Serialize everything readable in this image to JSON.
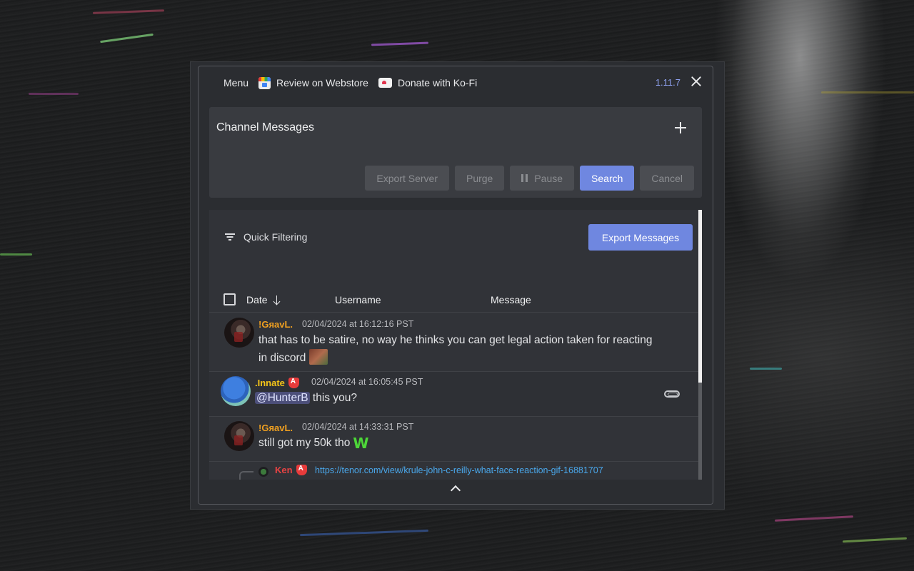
{
  "topbar": {
    "menu_label": "Menu",
    "review_label": "Review on Webstore",
    "donate_label": "Donate with Ko-Fi",
    "version": "1.11.7"
  },
  "channel_card": {
    "title": "Channel Messages",
    "buttons": {
      "export_server": "Export Server",
      "purge": "Purge",
      "pause": "Pause",
      "search": "Search",
      "cancel": "Cancel"
    }
  },
  "messages_panel": {
    "quick_filter_label": "Quick Filtering",
    "export_messages_label": "Export Messages",
    "columns": {
      "date": "Date",
      "username": "Username",
      "message": "Message"
    },
    "rows": [
      {
        "username": "!GяavL.",
        "username_color": "#f0a020",
        "timestamp": "02/04/2024 at 16:12:16 PST",
        "text_line1": "that has to be satire, no way he thinks you can get legal action taken for reacting",
        "text_line2": "in discord"
      },
      {
        "username": ".Innate",
        "username_color": "#f5c518",
        "timestamp": "02/04/2024 at 16:05:45 PST",
        "mention": "@HunterB",
        "text": " this you?"
      },
      {
        "username": "!GяavL.",
        "username_color": "#f0a020",
        "timestamp": "02/04/2024 at 14:33:31 PST",
        "text": "still got my 50k tho",
        "emoji": "W"
      }
    ],
    "reply": {
      "username": "Ken",
      "link": "https://tenor.com/view/krule-john-c-reilly-what-face-reaction-gif-16881707"
    }
  },
  "icons": {
    "menu": "hamburger-icon",
    "review": "webstore-icon",
    "donate": "kofi-cup-icon",
    "close": "close-icon",
    "add": "plus-icon",
    "pause": "pause-icon",
    "filter": "filter-icon",
    "sort": "arrow-down-icon",
    "attachment": "paperclip-icon",
    "scroll_top": "chevron-up-icon"
  },
  "colors": {
    "accent": "#6f87e0",
    "version": "#8fa2f0",
    "link": "#4aa8ec",
    "mod_badge": "#e83b3b"
  }
}
